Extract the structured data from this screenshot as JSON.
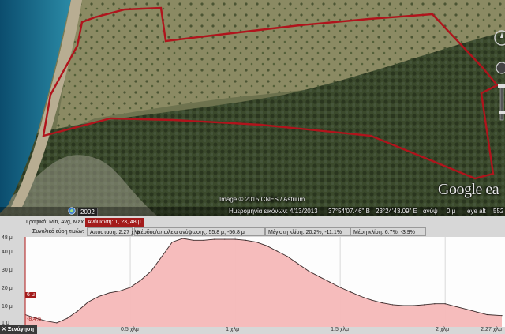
{
  "map": {
    "attribution": "Image © 2015 CNES / Astrium",
    "imagery_date_label": "Ημερομηνία εικόνων: 4/13/2013",
    "lat": "37°54'07.46\" Β",
    "lon": "23°24'43.09\" Ε",
    "elev_label": "ανύψ",
    "elev_value": "0 μ",
    "eye_alt_label": "eye alt",
    "eye_alt_value": "552",
    "logo": "Google ea",
    "year_badge": "2002",
    "track_color": "#b0141c"
  },
  "profile": {
    "row1": {
      "graph_label": "Γραφικό: Min, Avg, Max",
      "elevation_label": "Ανύψωση: 1, 23, 48 μ"
    },
    "row2": {
      "summary_label": "Συνολικό εύρη τιμών:",
      "distance": "Απόσταση: 2.27 χλμ",
      "gain_loss": "Κέρδος/απώλεια ανύψωσης: 55.8 μ, -56.8 μ",
      "max_slope": "Μέγιστη κλίση: 20.2%, -11.1%",
      "avg_slope": "Μέση κλίση: 6.7%, -3.9%"
    },
    "y_ticks": [
      "48 μ",
      "40 μ",
      "30 μ",
      "20 μ",
      "10 μ",
      "1 μ"
    ],
    "x_ticks": [
      "0.5 χλμ",
      "1 χλμ",
      "1.5 χλμ",
      "2 χλμ",
      "2.27 χλμ"
    ],
    "cursor_value": "6 μ",
    "cursor_slope": "-8.4%",
    "close_label": "✕ Ξενάγηση",
    "fill_color": "#f6b8b8",
    "line_color": "#3a2a2a"
  },
  "chart_data": {
    "type": "area",
    "x": [
      0,
      0.05,
      0.1,
      0.15,
      0.2,
      0.25,
      0.3,
      0.35,
      0.4,
      0.45,
      0.5,
      0.55,
      0.6,
      0.65,
      0.7,
      0.75,
      0.8,
      0.85,
      0.9,
      0.95,
      1.0,
      1.05,
      1.1,
      1.15,
      1.2,
      1.25,
      1.3,
      1.35,
      1.4,
      1.45,
      1.5,
      1.55,
      1.6,
      1.65,
      1.7,
      1.75,
      1.8,
      1.85,
      1.9,
      1.95,
      2.0,
      2.05,
      2.1,
      2.15,
      2.2,
      2.27
    ],
    "values": [
      6,
      4,
      2.5,
      1.5,
      4,
      8,
      13,
      16,
      18,
      19,
      21,
      25,
      30,
      38,
      46,
      48,
      47,
      47,
      47.5,
      47.5,
      47.5,
      47,
      46,
      44,
      41,
      38,
      34,
      30,
      27,
      24,
      21,
      18.5,
      16,
      14,
      12.5,
      11.5,
      11,
      11,
      11.5,
      12,
      12,
      10.5,
      9,
      7.5,
      6,
      5.5
    ],
    "xlim": [
      0,
      2.27
    ],
    "ylim": [
      1,
      48
    ],
    "grid": true
  }
}
